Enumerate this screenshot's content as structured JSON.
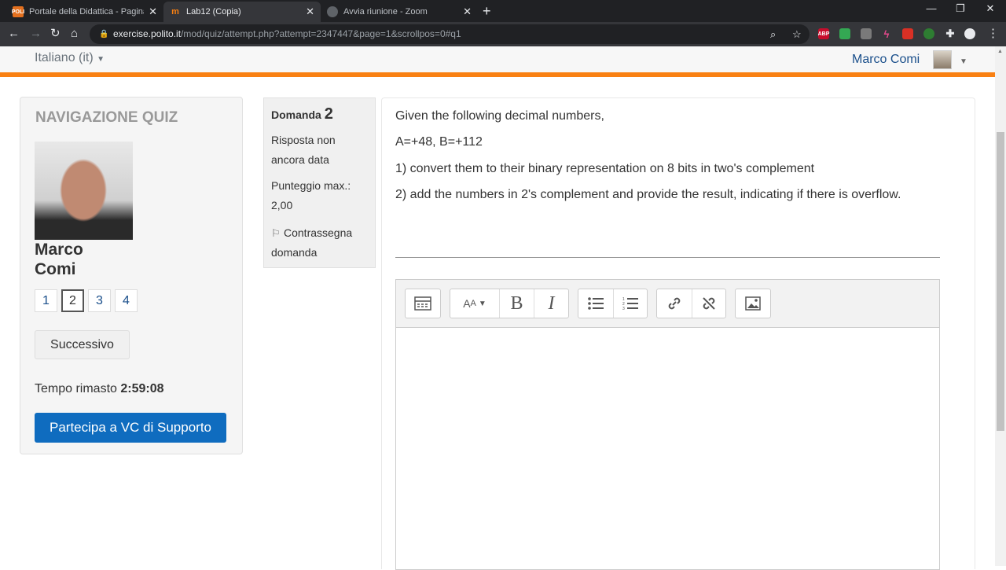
{
  "browser": {
    "tabs": [
      {
        "title": "Portale della Didattica - Pagina d",
        "favicon_text": "POLI",
        "favicon_color": "#e4701e"
      },
      {
        "title": "Lab12 (Copia)",
        "favicon_text": "m",
        "favicon_color": "#f98012"
      },
      {
        "title": "Avvia riunione - Zoom",
        "favicon_text": "",
        "favicon_color": "#5f6368"
      }
    ],
    "url_host": "exercise.polito.it",
    "url_path": "/mod/quiz/attempt.php?attempt=2347447&page=1&scrollpos=0#q1",
    "extensions": [
      {
        "label": "ABP",
        "color": "#c70d2c"
      },
      {
        "label": "",
        "color": "#34a853"
      },
      {
        "label": "",
        "color": "#7a7a7a"
      },
      {
        "label": "",
        "color": "#e64a8d"
      },
      {
        "label": "",
        "color": "#d93025"
      },
      {
        "label": "",
        "color": "#2e7d32"
      }
    ]
  },
  "header": {
    "language": "Italiano (it)",
    "user_name": "Marco Comi"
  },
  "quiz_nav": {
    "title": "NAVIGAZIONE QUIZ",
    "user_first": "Marco",
    "user_last": "Comi",
    "questions": [
      "1",
      "2",
      "3",
      "4"
    ],
    "current_question": "2",
    "next_label": "Successivo",
    "timer_label": "Tempo rimasto",
    "timer_value": "2:59:08",
    "vc_label": "Partecipa a VC di Supporto"
  },
  "question_info": {
    "label": "Domanda",
    "number": "2",
    "state": "Risposta non ancora data",
    "grade": "Punteggio max.: 2,00",
    "flag_label": "Contrassegna domanda"
  },
  "question": {
    "line1": "Given the following decimal numbers,",
    "line2": "A=+48, B=+112",
    "line3": "1) convert them to their binary representation on 8 bits in two's complement",
    "line4": "2) add the numbers in 2's complement and provide the result, indicating if there is overflow."
  },
  "editor_toolbar": [
    "toolbar-toggle",
    "font-size",
    "bold",
    "italic",
    "bullet-list",
    "numbered-list",
    "link",
    "unlink",
    "image"
  ]
}
